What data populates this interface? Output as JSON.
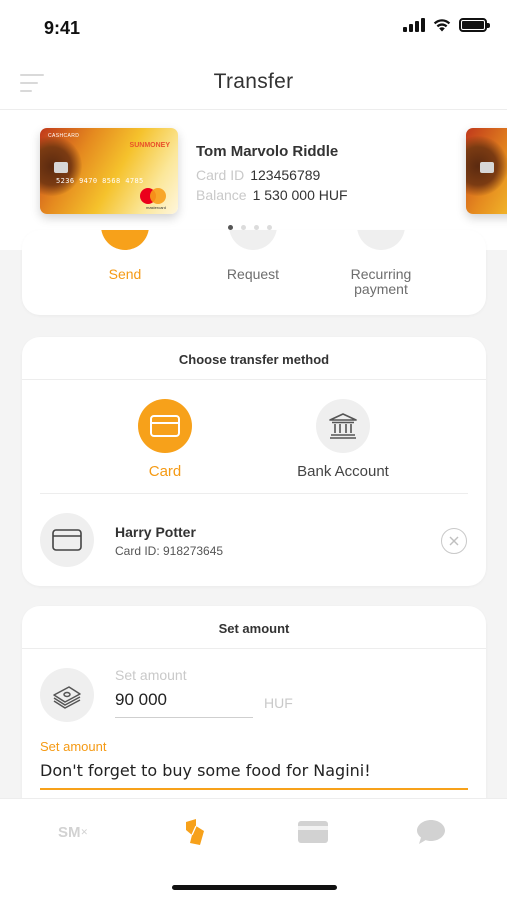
{
  "status_bar": {
    "time": "9:41"
  },
  "nav": {
    "title": "Transfer"
  },
  "card_carousel": {
    "card": {
      "label": "CASHCARD",
      "brand": "SUNMONEY",
      "number": "5236  9470  8568  4785",
      "network_text": "mastercard"
    },
    "holder_name": "Tom Marvolo Riddle",
    "card_id_label": "Card ID",
    "card_id": "123456789",
    "balance_label": "Balance",
    "balance": "1 530 000 HUF",
    "page_count": 4,
    "active_page": 1
  },
  "actions": {
    "send": "Send",
    "request": "Request",
    "recurring": "Recurring payment"
  },
  "transfer_method": {
    "title": "Choose transfer method",
    "card_label": "Card",
    "bank_label": "Bank Account",
    "selected": "Card",
    "recipient_name": "Harry Potter",
    "recipient_card_id": "Card ID: 918273645"
  },
  "amount": {
    "title": "Set amount",
    "amount_placeholder": "Set amount",
    "amount_value": "90 000",
    "currency": "HUF",
    "note_label": "Set amount",
    "note_value": "Don't forget to buy some food for Nagini!"
  },
  "tab_bar": {
    "sm_label": "SM",
    "active_tab": "transfer"
  },
  "colors": {
    "accent": "#f7a11a",
    "accent_text": "#f59a14",
    "inactive_icon": "#d2d2d2"
  }
}
